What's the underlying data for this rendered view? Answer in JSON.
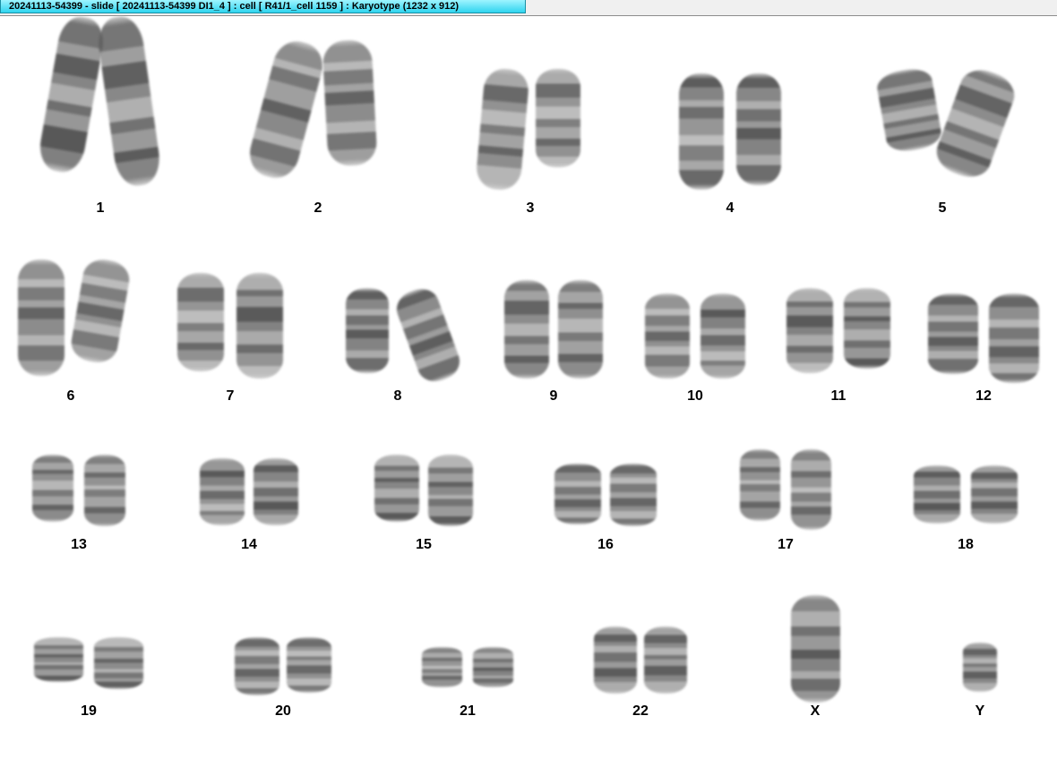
{
  "window": {
    "title": "20241113-54399 - slide [ 20241113-54399 DI1_4 ] : cell [ R41/1_cell 1159 ] : Karyotype  (1232 x 912)"
  },
  "karyotype": {
    "labels": [
      "1",
      "2",
      "3",
      "4",
      "5",
      "6",
      "7",
      "8",
      "9",
      "10",
      "11",
      "12",
      "13",
      "14",
      "15",
      "16",
      "17",
      "18",
      "19",
      "20",
      "21",
      "22",
      "X",
      "Y"
    ]
  }
}
